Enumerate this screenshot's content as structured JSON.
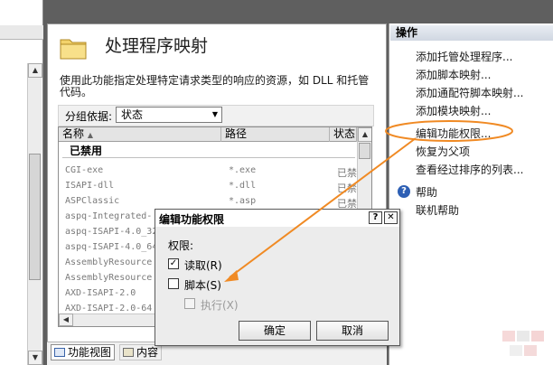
{
  "feature": {
    "title": "处理程序映射",
    "description": "使用此功能指定处理特定请求类型的响应的资源，如 DLL 和托管代码。",
    "group_by_label": "分组依据:",
    "group_by_value": "状态"
  },
  "list": {
    "columns": [
      "名称",
      "路径",
      "状态"
    ],
    "group_name": "已禁用",
    "rows": [
      {
        "name": "CGI-exe",
        "path": "*.exe",
        "status": "已禁"
      },
      {
        "name": "ISAPI-dll",
        "path": "*.dll",
        "status": "已禁"
      },
      {
        "name": "ASPClassic",
        "path": "*.asp",
        "status": "已禁"
      },
      {
        "name": "aspq-Integrated-",
        "path": "",
        "status": ""
      },
      {
        "name": "aspq-ISAPI-4.0_32",
        "path": "",
        "status": ""
      },
      {
        "name": "aspq-ISAPI-4.0_64",
        "path": "",
        "status": ""
      },
      {
        "name": "AssemblyResource",
        "path": "",
        "status": ""
      },
      {
        "name": "AssemblyResource",
        "path": "",
        "status": ""
      },
      {
        "name": "AXD-ISAPI-2.0",
        "path": "",
        "status": ""
      },
      {
        "name": "AXD-ISAPI-2.0-64",
        "path": "",
        "status": ""
      }
    ]
  },
  "tabs": {
    "features_view": "功能视图",
    "content_view": "内容"
  },
  "actions": {
    "header": "操作",
    "items": [
      "添加托管处理程序...",
      "添加脚本映射...",
      "添加通配符脚本映射...",
      "添加模块映射...",
      "编辑功能权限...",
      "恢复为父项",
      "查看经过排序的列表..."
    ],
    "help": "帮助",
    "online_help": "联机帮助"
  },
  "dialog": {
    "title": "编辑功能权限",
    "help_glyph": "?",
    "close_glyph": "✕",
    "permissions_label": "权限:",
    "read_label": "读取(R)",
    "read_checked": true,
    "script_label": "脚本(S)",
    "script_checked": false,
    "execute_label": "执行(X)",
    "execute_checked": false,
    "execute_enabled": false,
    "ok": "确定",
    "cancel": "取消"
  },
  "colors": {
    "annotation": "#f08a24",
    "link_text": "#1b1b1b"
  },
  "icons": {
    "folder": "folder-icon",
    "help": "help-icon",
    "check": "✓"
  }
}
